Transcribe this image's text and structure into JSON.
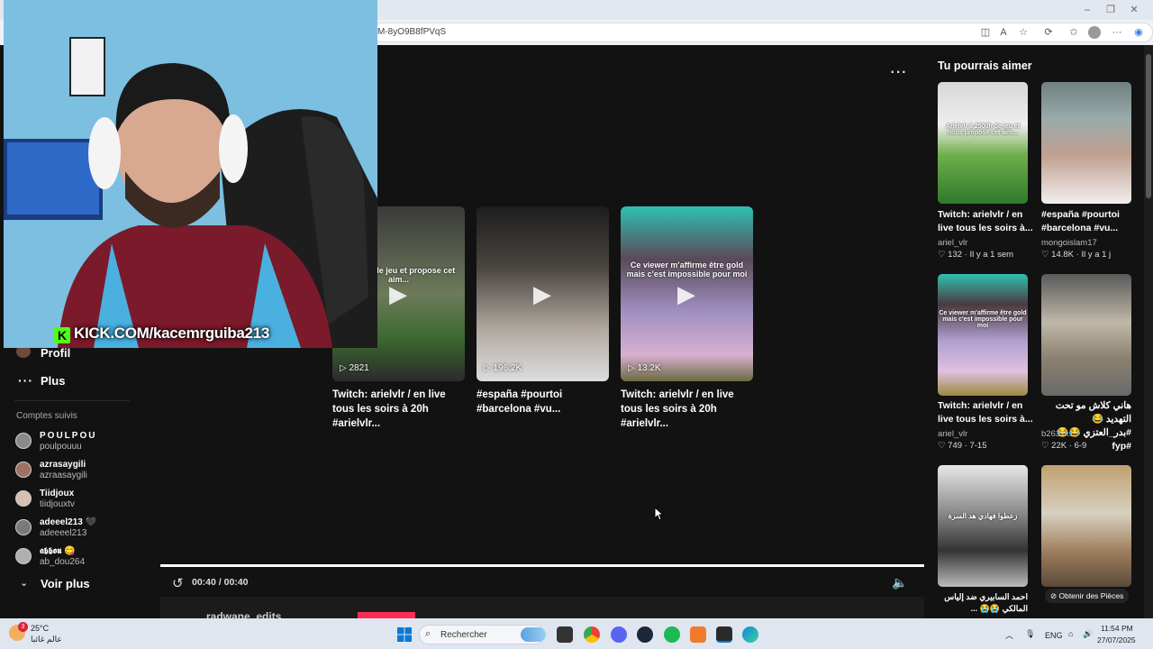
{
  "browser": {
    "address_fragment": "M-8yO9B8fPVqS",
    "window_controls": [
      "–",
      "❐",
      "✕"
    ]
  },
  "player": {
    "more_label": "···",
    "time": "00:40 / 00:40",
    "author": "radwane_edits"
  },
  "related_videos": [
    {
      "caption": "à 2500h de jeu et propose cet aim...",
      "views": "2821",
      "title": "Twitch: arielvlr / en live tous les soirs à 20h #arielvlr..."
    },
    {
      "caption": "",
      "views": "196.2K",
      "title": "#españa #pourtoi #barcelona #vu..."
    },
    {
      "caption": "Ce viewer m'affirme être gold mais c'est impossible pour moi",
      "views": "13.2K",
      "title": "Twitch: arielvlr / en live tous les soirs à 20h #arielvlr..."
    }
  ],
  "sidebar": {
    "profile": "Profil",
    "more": "Plus",
    "followed_title": "Comptes suivis",
    "accounts": [
      {
        "name": "POULPOU",
        "handle": "poulpouuu"
      },
      {
        "name": "azrasaygili",
        "handle": "azraasaygili"
      },
      {
        "name": "Tiidjoux",
        "handle": "tiidjouxtv"
      },
      {
        "name": "adeeel213 🖤",
        "handle": "adeeeel213"
      },
      {
        "name": "𝖆𝖇𝖇𝖔𝖚 😋",
        "handle": "ab_dou264"
      }
    ],
    "see_more": "Voir plus"
  },
  "recommendations": {
    "title": "Tu pourrais aimer",
    "items": [
      {
        "caption": "Arielvlr à 2500h de jeu et nous propose cet aim...",
        "title": "Twitch: arielvlr / en live tous les soirs à...",
        "author": "ariel_vlr",
        "likes": "132",
        "date": "Il y a 1 sem"
      },
      {
        "caption": "",
        "title": "#españa #pourtoi #barcelona #vu...",
        "author": "mongoislam17",
        "likes": "14.8K",
        "date": "Il y a 1 j"
      },
      {
        "caption": "Ce viewer m'affirme être gold mais c'est impossible pour moi",
        "title": "Twitch: arielvlr / en live tous les soirs à...",
        "author": "ariel_vlr",
        "likes": "749",
        "date": "7-15"
      },
      {
        "caption": "",
        "title": "هاني كلاش مو تحت التهديد 😂 #بدر_العتزي 😂😂 #fyp",
        "author": "b263xx1",
        "likes": "22K",
        "date": "6-9"
      },
      {
        "caption": "زعطوا فهادي هد السرة",
        "title": "احمد السابيري ضد إلياس المالكي 😭😭 ...",
        "author": "",
        "likes": "",
        "date": ""
      },
      {
        "caption": "",
        "title": "",
        "author": "",
        "likes": "",
        "date": ""
      }
    ],
    "coins_badge": "Obtenir des Pièces"
  },
  "webcam": {
    "banner": "KICK.COM/kacemrguiba213",
    "logo": "K"
  },
  "taskbar": {
    "weather_temp": "25°C",
    "weather_text": "عالم غائبا",
    "notif_count": "3",
    "search_placeholder": "Rechercher",
    "lang": "ENG",
    "time": "11:54 PM",
    "date": "27/07/2025"
  },
  "colors": {
    "accent_pink": "#fe2c55",
    "kick_green": "#53fc18",
    "page_bg": "#121212"
  }
}
